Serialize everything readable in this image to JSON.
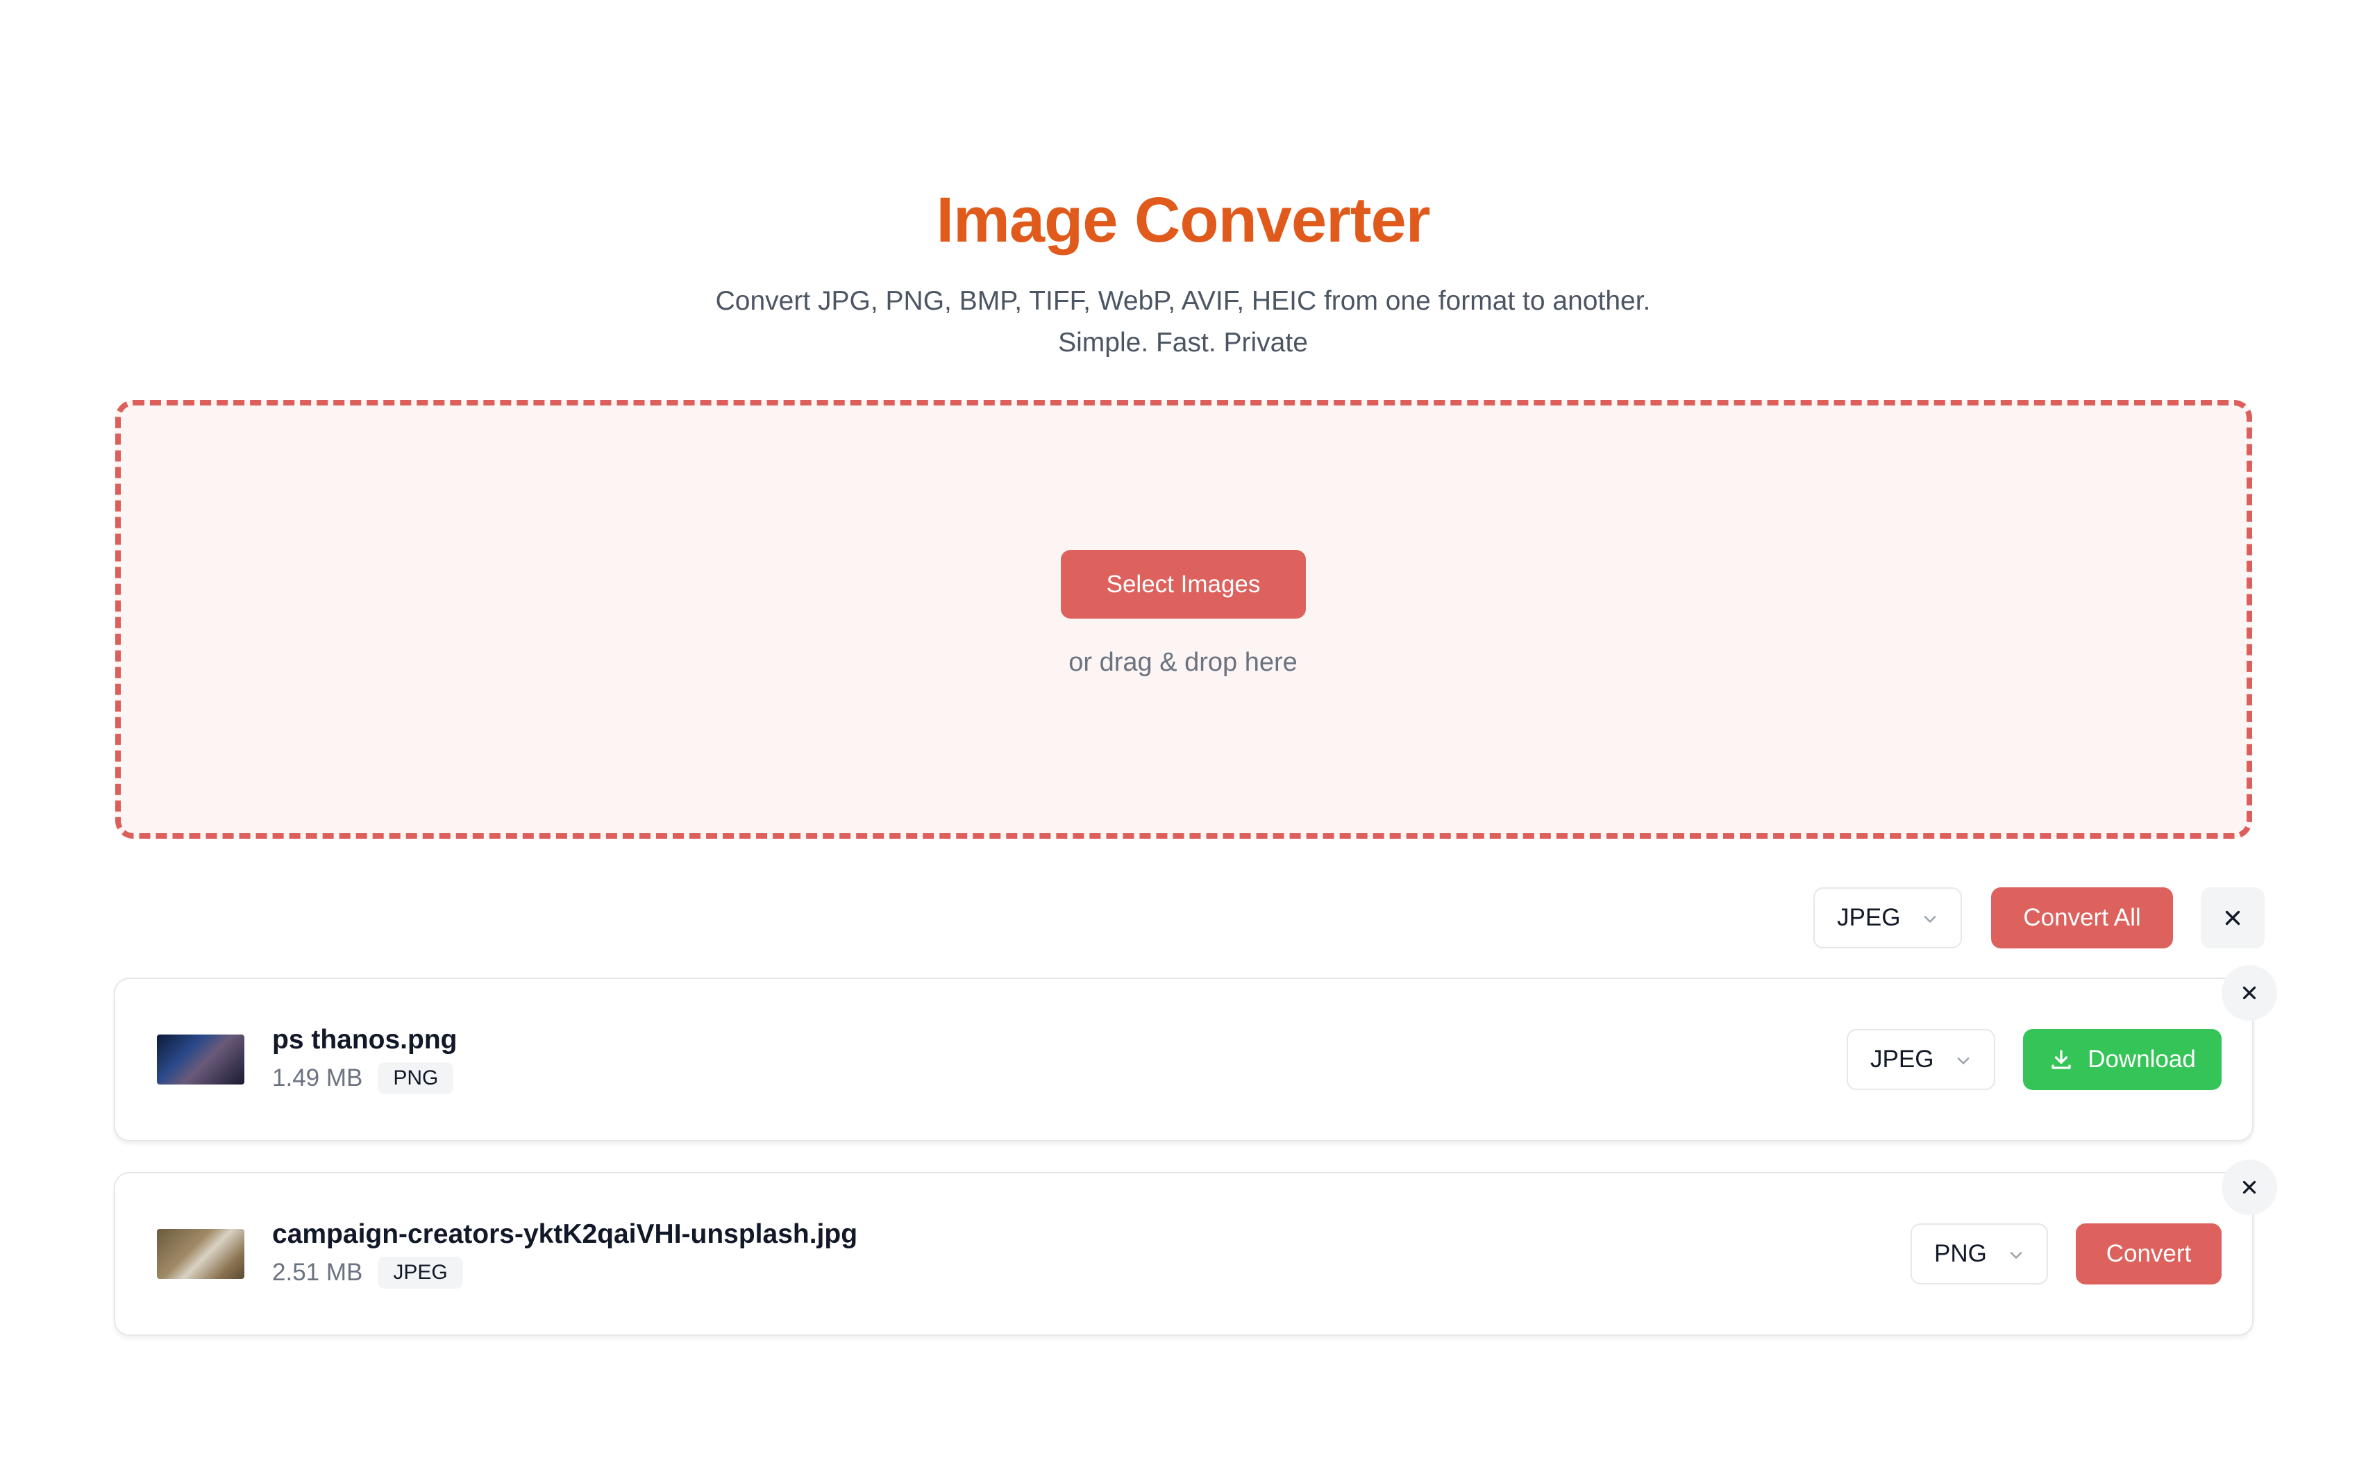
{
  "header": {
    "title": "Image Converter",
    "subtitle_line1": "Convert JPG, PNG, BMP, TIFF, WebP, AVIF, HEIC from one format to another.",
    "subtitle_line2": "Simple. Fast. Private"
  },
  "dropzone": {
    "select_label": "Select Images",
    "hint": "or drag & drop here"
  },
  "toolbar": {
    "format_selected": "JPEG",
    "convert_all_label": "Convert All"
  },
  "files": [
    {
      "name": "ps thanos.png",
      "size": "1.49 MB",
      "type": "PNG",
      "target_format": "JPEG",
      "action_label": "Download"
    },
    {
      "name": "campaign-creators-yktK2qaiVHI-unsplash.jpg",
      "size": "2.51 MB",
      "type": "JPEG",
      "target_format": "PNG",
      "action_label": "Convert"
    }
  ],
  "colors": {
    "accent": "#dd625d",
    "title": "#e05a1c",
    "success": "#35c457",
    "dropzone_bg": "#fcf5f4"
  },
  "icons": {
    "close": "close-icon",
    "chevron": "chevron-down-icon",
    "download": "download-icon"
  }
}
